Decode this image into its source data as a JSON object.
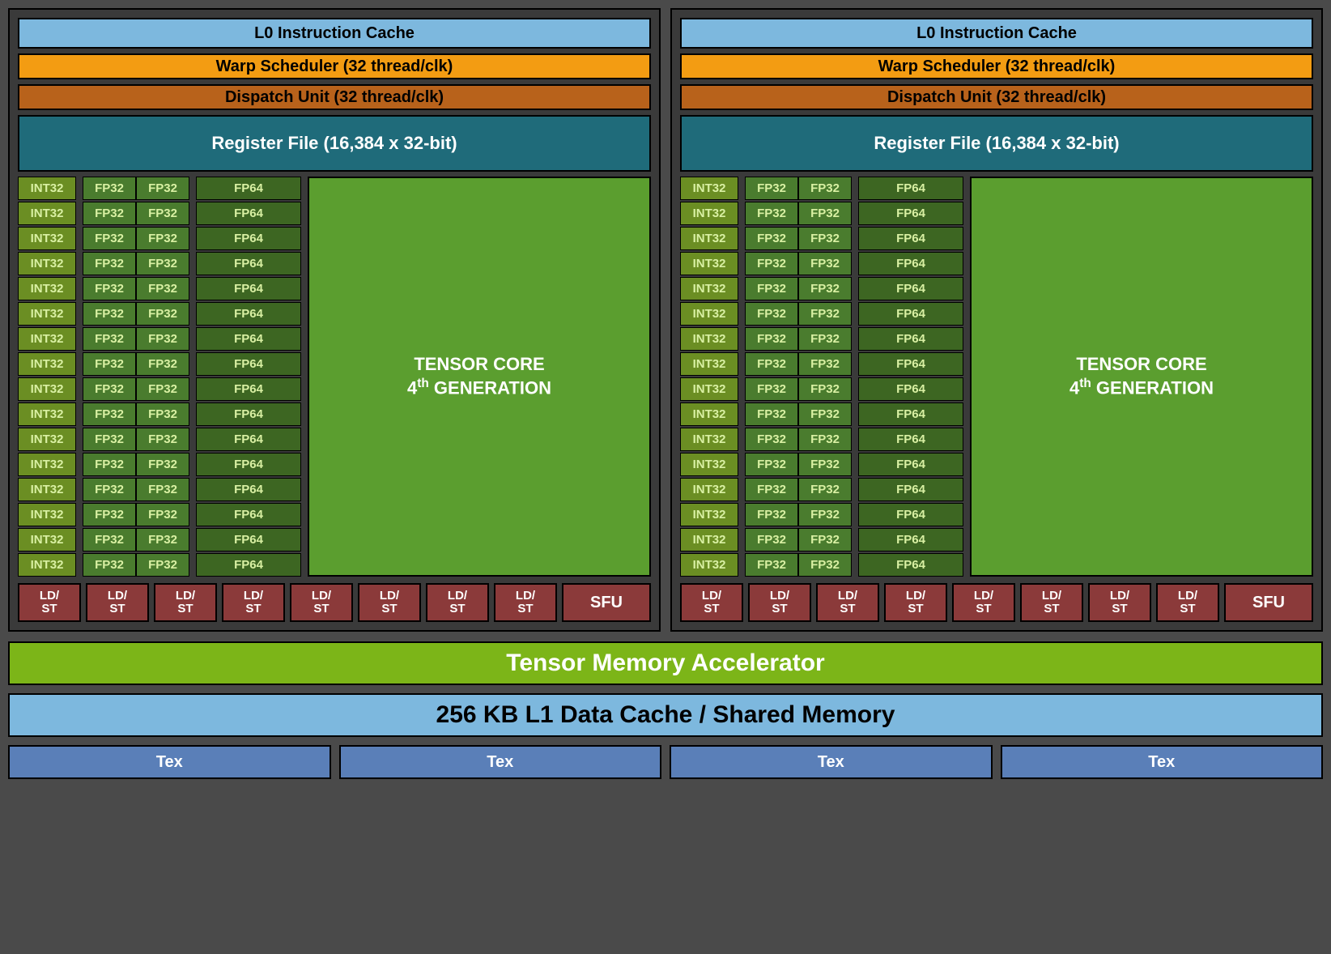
{
  "sm": {
    "l0cache": "L0 Instruction Cache",
    "warp": "Warp Scheduler (32 thread/clk)",
    "dispatch": "Dispatch Unit (32 thread/clk)",
    "regfile": "Register File (16,384 x 32-bit)",
    "units": {
      "int32": "INT32",
      "fp32": "FP32",
      "fp64": "FP64",
      "int32_count": 16,
      "fp32_count": 32,
      "fp64_count": 16
    },
    "tensor_line1": "TENSOR CORE",
    "tensor_line2_prefix": "4",
    "tensor_line2_suffix": " GENERATION",
    "ldst": "LD/\nST",
    "ldst_count": 8,
    "sfu": "SFU"
  },
  "tma": "Tensor Memory Accelerator",
  "l1": "256 KB L1 Data Cache / Shared Memory",
  "tex": "Tex",
  "tex_count": 4
}
